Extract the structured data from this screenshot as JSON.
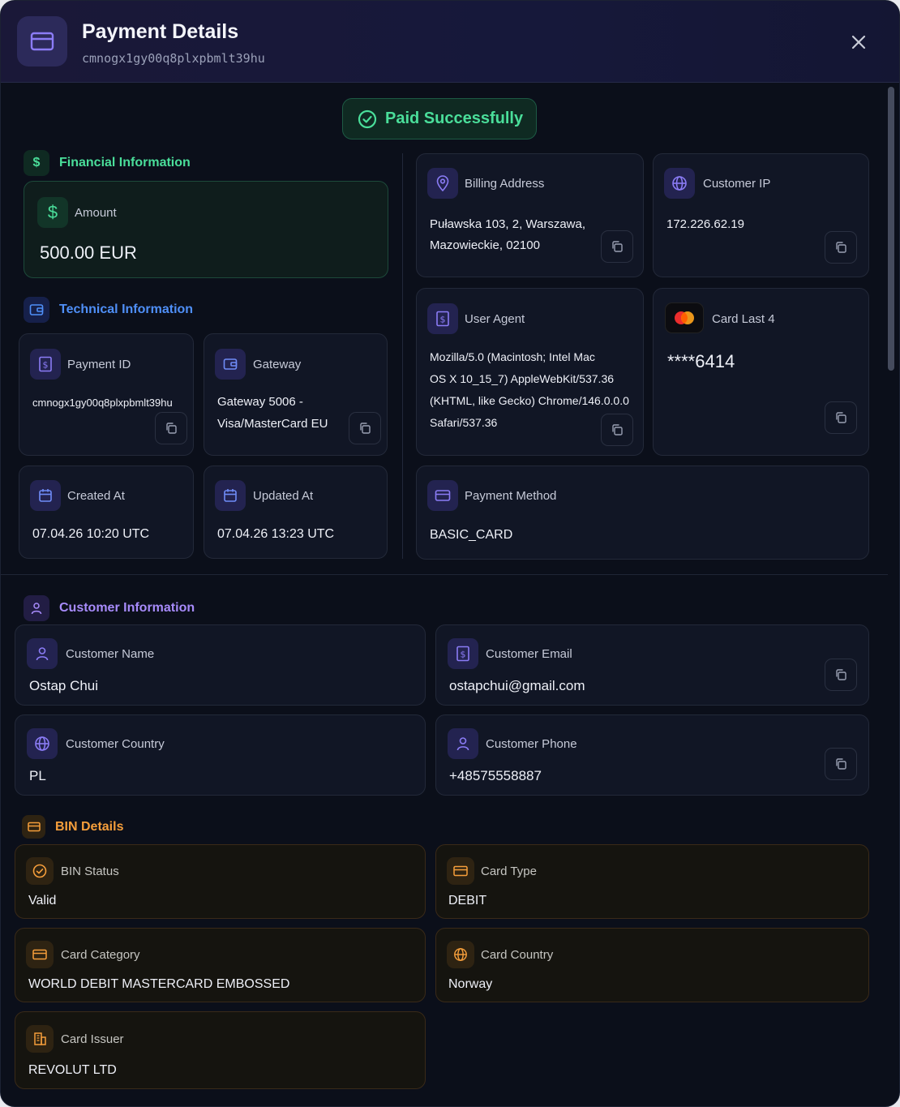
{
  "header": {
    "title": "Payment Details",
    "subtitle": "cmnogx1gy00q8plxpbmlt39hu"
  },
  "status": {
    "label": "Paid Successfully"
  },
  "financial": {
    "section_title": "Financial Information",
    "amount_label": "Amount",
    "amount_value": "500.00 EUR"
  },
  "technical": {
    "section_title": "Technical Information",
    "payment_id_label": "Payment ID",
    "payment_id_value": "cmnogx1gy00q8plxpbmlt39hu",
    "gateway_label": "Gateway",
    "gateway_line1": "Gateway 5006 -",
    "gateway_line2": "Visa/MasterCard EU",
    "created_label": "Created At",
    "created_value": "07.04.26 10:20 UTC",
    "updated_label": "Updated At",
    "updated_value": "07.04.26 13:23 UTC"
  },
  "billing": {
    "label": "Billing Address",
    "line1": "Puławska 103, 2, Warszawa,",
    "line2": "Mazowieckie, 02100"
  },
  "customer_ip": {
    "label": "Customer IP",
    "value": "172.226.62.19"
  },
  "user_agent": {
    "label": "User Agent",
    "line1": "Mozilla/5.0 (Macintosh; Intel Mac",
    "line2": "OS X 10_15_7) AppleWebKit/537.36",
    "line3": "(KHTML, like Gecko) Chrome/146.0.0.0",
    "line4": "Safari/537.36"
  },
  "card_last4": {
    "label": "Card Last 4",
    "value": "****6414"
  },
  "payment_method": {
    "label": "Payment Method",
    "value": "BASIC_CARD"
  },
  "customer": {
    "section_title": "Customer Information",
    "name_label": "Customer Name",
    "name_value": "Ostap Chui",
    "email_label": "Customer Email",
    "email_value": "ostapchui@gmail.com",
    "country_label": "Customer Country",
    "country_value": "PL",
    "phone_label": "Customer Phone",
    "phone_value": "+48575558887"
  },
  "bin": {
    "section_title": "BIN Details",
    "status_label": "BIN Status",
    "status_value": "Valid",
    "type_label": "Card Type",
    "type_value": "DEBIT",
    "category_label": "Card Category",
    "category_value": "WORLD DEBIT MASTERCARD EMBOSSED",
    "country_label": "Card Country",
    "country_value": "Norway",
    "issuer_label": "Card Issuer",
    "issuer_value": "REVOLUT LTD"
  },
  "colors": {
    "green": "#4ade9a",
    "blue": "#4f8ff7",
    "purple": "#a78bfa",
    "orange": "#f59e3b"
  }
}
